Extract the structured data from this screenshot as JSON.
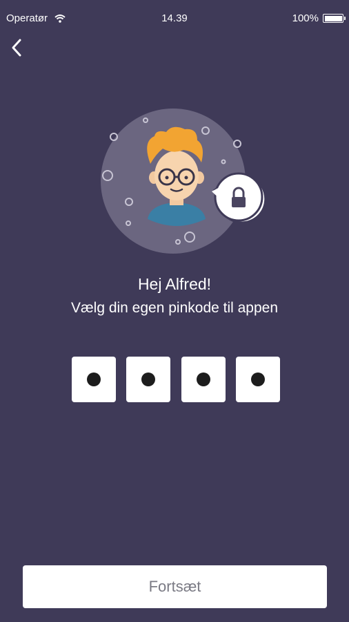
{
  "status_bar": {
    "carrier": "Operatør",
    "time": "14.39",
    "battery": "100%",
    "battery_level": 1.0
  },
  "nav": {
    "back_icon": "chevron-left-icon"
  },
  "illustration": {
    "avatar_icon": "boy-with-glasses-avatar",
    "lock_icon": "lock-icon",
    "circle_color": "#6b6680",
    "hair_color": "#f2a432",
    "shirt_color": "#3a7fa5"
  },
  "greeting": "Hej Alfred!",
  "subtitle": "Vælg din egen pinkode til appen",
  "pin": {
    "digits_entered": 4,
    "boxes": [
      {
        "filled": true
      },
      {
        "filled": true
      },
      {
        "filled": true
      },
      {
        "filled": true
      }
    ]
  },
  "continue_button": {
    "label": "Fortsæt"
  },
  "colors": {
    "background": "#3f3a58",
    "button_bg": "#ffffff",
    "button_text": "#7a7a84"
  }
}
